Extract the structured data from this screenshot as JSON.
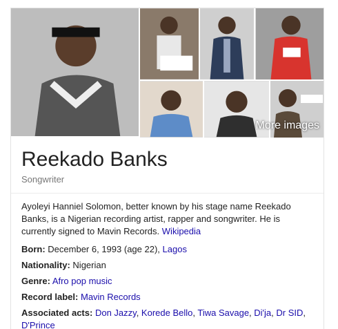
{
  "gallery": {
    "more_images_label": "More images"
  },
  "entity": {
    "name": "Reekado Banks",
    "type": "Songwriter",
    "description": "Ayoleyi Hanniel Solomon, better known by his stage name Reekado Banks, is a Nigerian recording artist, rapper and songwriter. He is currently signed to Mavin Records.",
    "source_link": "Wikipedia"
  },
  "facts": {
    "born": {
      "label": "Born:",
      "value": "December 6, 1993 (age 22),",
      "place_link": "Lagos"
    },
    "nationality": {
      "label": "Nationality:",
      "value": "Nigerian"
    },
    "genre": {
      "label": "Genre:",
      "link": "Afro pop music"
    },
    "record_label": {
      "label": "Record label:",
      "link": "Mavin Records"
    },
    "associated_acts": {
      "label": "Associated acts:",
      "acts": [
        "Don Jazzy",
        "Korede Bello",
        "Tiwa Savage",
        "Di'ja",
        "Dr SID",
        "D'Prince"
      ]
    }
  },
  "colors": {
    "link": "#1a0dab",
    "text": "#222222",
    "muted": "#777777"
  }
}
